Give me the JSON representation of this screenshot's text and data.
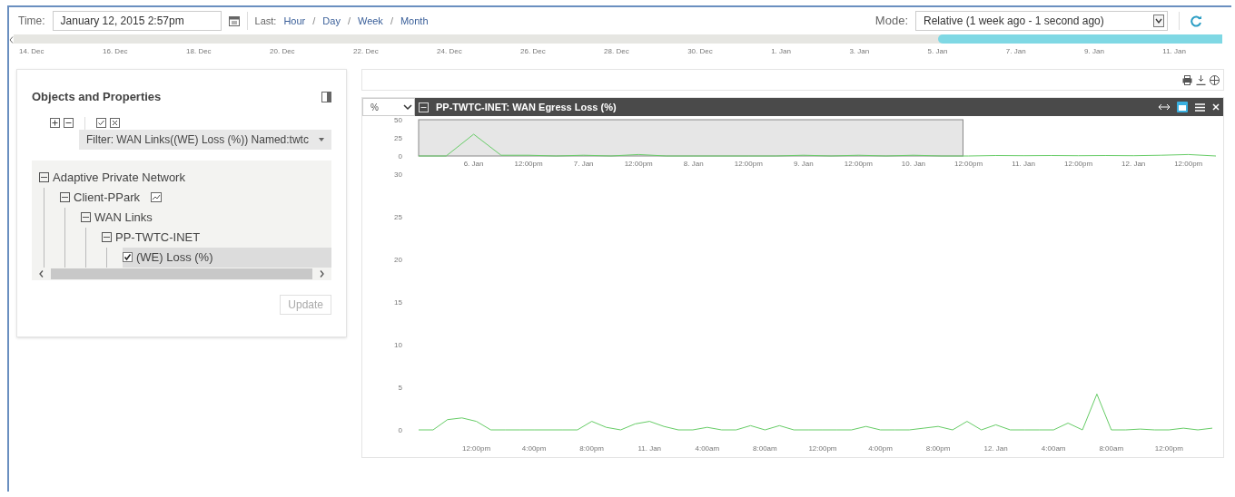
{
  "toolbar": {
    "time_label": "Time:",
    "time_value": "January 12, 2015 2:57pm",
    "last_label": "Last:",
    "last_links": [
      "Hour",
      "Day",
      "Week",
      "Month"
    ],
    "separator": "/",
    "mode_label": "Mode:",
    "mode_value": "Relative (1 week ago - 1 second ago)"
  },
  "timeline": {
    "level": 0.235,
    "labels": [
      "14. Dec",
      "16. Dec",
      "18. Dec",
      "20. Dec",
      "22. Dec",
      "24. Dec",
      "26. Dec",
      "28. Dec",
      "30. Dec",
      "1. Jan",
      "3. Jan",
      "5. Jan",
      "7. Jan",
      "9. Jan",
      "11. Jan"
    ]
  },
  "objects_panel": {
    "title": "Objects and Properties",
    "filter": "Filter: WAN Links((WE) Loss (%)) Named:twtc",
    "update_button": "Update",
    "tree": [
      {
        "label": "Adaptive Private Network",
        "kind": "folder",
        "expanded": true,
        "selected": false,
        "children": [
          {
            "label": "Client-PPark",
            "kind": "folder",
            "expanded": true,
            "selected": false,
            "children": [
              {
                "label": "WAN Links",
                "kind": "folder",
                "expanded": true,
                "selected": false,
                "children": [
                  {
                    "label": "PP-TWTC-INET",
                    "kind": "folder",
                    "expanded": true,
                    "selected": false,
                    "children": [
                      {
                        "label": "(WE) Loss (%)",
                        "kind": "checkbox",
                        "checked": true,
                        "selected": true
                      }
                    ]
                  }
                ]
              }
            ]
          }
        ]
      }
    ]
  },
  "chart_panel": {
    "unit": "%",
    "title": "PP-TWTC-INET: WAN Egress Loss (%)",
    "navigator": {
      "chart_data": {
        "type": "line",
        "categories": [
          null,
          null,
          "6. Jan",
          null,
          "12:00pm",
          null,
          "7. Jan",
          null,
          "12:00pm",
          null,
          "8. Jan",
          null,
          "12:00pm",
          null,
          "9. Jan",
          null,
          "12:00pm",
          null,
          "10. Jan",
          null,
          "12:00pm",
          null,
          "11. Jan",
          null,
          "12:00pm",
          null,
          "12. Jan",
          null,
          "12:00pm",
          null
        ],
        "series": [
          {
            "color": "#66cc66",
            "values": [
              0,
              0,
              30,
              1,
              1,
              0,
              1,
              0,
              2,
              0,
              0,
              0,
              0,
              0,
              1,
              0,
              1,
              0,
              1,
              0,
              0,
              0.6,
              0.4,
              0.6,
              0.4,
              0.6,
              0.4,
              1,
              2,
              0
            ]
          }
        ],
        "ylim": [
          0,
          50
        ],
        "yticks": [
          0,
          25,
          50
        ]
      }
    },
    "chart_data": {
      "type": "line",
      "categories": [
        null,
        null,
        null,
        null,
        "12:00pm",
        null,
        null,
        null,
        "4:00pm",
        null,
        null,
        null,
        "8:00pm",
        null,
        null,
        null,
        "11. Jan",
        null,
        null,
        null,
        "4:00am",
        null,
        null,
        null,
        "8:00am",
        null,
        null,
        null,
        "12:00pm",
        null,
        null,
        null,
        "4:00pm",
        null,
        null,
        null,
        "8:00pm",
        null,
        null,
        null,
        "12. Jan",
        null,
        null,
        null,
        "4:00am",
        null,
        null,
        null,
        "8:00am",
        null,
        null,
        null,
        "12:00pm",
        null,
        null,
        null
      ],
      "series": [
        {
          "color": "#66cc66",
          "values": [
            0,
            0,
            1.2,
            1.4,
            1.0,
            0,
            0,
            0,
            0,
            0,
            0,
            0,
            1.0,
            0.3,
            0,
            0.7,
            1.0,
            0.4,
            0,
            0,
            0.3,
            0,
            0,
            0.5,
            0,
            0.5,
            0,
            0,
            0,
            0,
            0,
            0.4,
            0,
            0,
            0,
            0.2,
            0.4,
            0,
            1.0,
            0,
            0.6,
            0,
            0,
            0,
            0,
            0.8,
            0,
            4.2,
            0,
            0,
            0.1,
            0,
            0,
            0.2,
            0,
            0.2
          ]
        }
      ],
      "ylim": [
        0,
        30
      ],
      "yticks": [
        0,
        5,
        10,
        15,
        20,
        25,
        30
      ]
    }
  }
}
